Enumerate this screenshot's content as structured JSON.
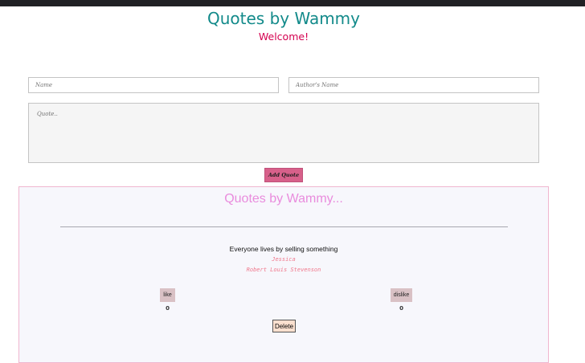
{
  "header": {
    "title": "Quotes by Wammy",
    "subtitle": "Welcome!"
  },
  "form": {
    "name_placeholder": "Name",
    "author_placeholder": "Author's Name",
    "quote_placeholder": "Quote..",
    "submit_label": "Add Quote"
  },
  "quotes_section": {
    "title": "Quotes by Wammy...",
    "items": [
      {
        "text": "Everyone lives by selling something",
        "name": "Jessica",
        "author": "Robert Louis Stevenson",
        "like_label": "like",
        "dislike_label": "dislike",
        "likes": "0",
        "dislikes": "0",
        "delete_label": "Delete"
      }
    ]
  },
  "colors": {
    "title": "#128a8a",
    "welcome": "#d4004f",
    "add_button": "#d7608a",
    "section_title": "#e98cdd",
    "quote_meta": "#f0788c",
    "vote_button": "#d9c1c5",
    "delete_button": "#fbe0cf"
  }
}
